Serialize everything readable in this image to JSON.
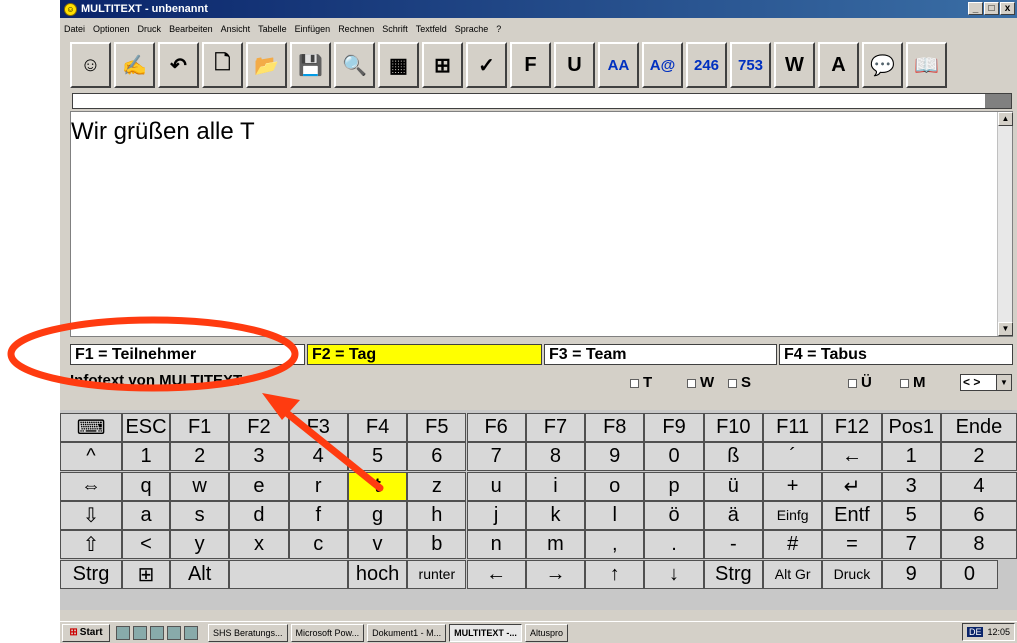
{
  "window": {
    "title": "MULTITEXT - unbenannt",
    "controls": [
      "_",
      "□",
      "x"
    ]
  },
  "menu": [
    "Datei",
    "Optionen",
    "Druck",
    "Bearbeiten",
    "Ansicht",
    "Tabelle",
    "Einfügen",
    "Rechnen",
    "Schrift",
    "Textfeld",
    "Sprache",
    "?"
  ],
  "toolbar": {
    "buttons": [
      {
        "icon": "smiley-icon",
        "glyph": "☺"
      },
      {
        "icon": "draw-icon",
        "glyph": "✍"
      },
      {
        "icon": "undo-icon",
        "glyph": "↶"
      },
      {
        "icon": "new-document-icon",
        "glyph": "🗋"
      },
      {
        "icon": "open-folder-icon",
        "glyph": "📂"
      },
      {
        "icon": "save-icon",
        "glyph": "💾"
      },
      {
        "icon": "print-preview-icon",
        "glyph": "🔍"
      },
      {
        "icon": "calculator-icon",
        "glyph": "▦"
      },
      {
        "icon": "table-icon",
        "glyph": "⊞"
      },
      {
        "icon": "spellcheck-icon",
        "glyph": "✓"
      },
      {
        "icon": "bold-icon",
        "glyph": "F"
      },
      {
        "icon": "underline-icon",
        "glyph": "U"
      },
      {
        "icon": "font-size-icon",
        "glyph": "AA"
      },
      {
        "icon": "font-style-icon",
        "glyph": "A@"
      },
      {
        "icon": "numbers-246-icon",
        "glyph": "246"
      },
      {
        "icon": "numbers-753-icon",
        "glyph": "753"
      },
      {
        "icon": "word-bubble-icon",
        "glyph": "W"
      },
      {
        "icon": "letter-bubble-icon",
        "glyph": "A"
      },
      {
        "icon": "speech-bubble-icon",
        "glyph": "💬"
      },
      {
        "icon": "book-icon",
        "glyph": "📖"
      }
    ]
  },
  "editor": {
    "text": "Wir grüßen alle T"
  },
  "fkeys": [
    {
      "label": "F1 = Teilnehmer",
      "highlight": false
    },
    {
      "label": "F2 = Tag",
      "highlight": true
    },
    {
      "label": "F3 = Team",
      "highlight": false
    },
    {
      "label": "F4 = Tabus",
      "highlight": false
    }
  ],
  "info": {
    "text": "Infotext von MULTITEXT",
    "checks_left": [
      "T",
      "W",
      "S"
    ],
    "checks_right": [
      "Ü",
      "M"
    ],
    "dropdown_value": "< >"
  },
  "keyboard": {
    "row1": [
      "⌨",
      "ESC",
      "F1",
      "F2",
      "F3",
      "F4",
      "F5",
      "F6",
      "F7",
      "F8",
      "F9",
      "F10",
      "F11",
      "F12",
      "Pos1",
      "Ende"
    ],
    "row2": [
      "^",
      "1",
      "2",
      "3",
      "4",
      "5",
      "6",
      "7",
      "8",
      "9",
      "0",
      "ß",
      "´",
      "←",
      "1",
      "2"
    ],
    "row3": [
      "⇔",
      "q",
      "w",
      "e",
      "r",
      "t",
      "z",
      "u",
      "i",
      "o",
      "p",
      "ü",
      "+",
      "↵",
      "3",
      "4"
    ],
    "row4": [
      "⇩",
      "a",
      "s",
      "d",
      "f",
      "g",
      "h",
      "j",
      "k",
      "l",
      "ö",
      "ä",
      "Einfg",
      "Entf",
      "5",
      "6"
    ],
    "row5": [
      "⇧",
      "<",
      "y",
      "x",
      "c",
      "v",
      "b",
      "n",
      "m",
      ",",
      ".",
      "-",
      "#",
      "=",
      "7",
      "8"
    ],
    "row6": [
      "Strg",
      "⊞",
      "Alt",
      "",
      "hoch",
      "runter",
      "←",
      "→",
      "↑",
      "↓",
      "Strg",
      "Alt Gr",
      "Druck",
      "9",
      "0"
    ],
    "highlighted_key": "t"
  },
  "taskbar": {
    "start": "Start",
    "tasks": [
      {
        "label": "SHS Beratungs...",
        "active": false
      },
      {
        "label": "Microsoft Pow...",
        "active": false
      },
      {
        "label": "Dokument1 - M...",
        "active": false
      },
      {
        "label": "MULTITEXT -...",
        "active": true
      },
      {
        "label": "Altuspro",
        "active": false
      }
    ],
    "clock": "12:05",
    "lang": "DE"
  },
  "colors": {
    "highlight": "#ffff00",
    "annotation": "#ff3b10",
    "titlebar": "#0a246a"
  }
}
